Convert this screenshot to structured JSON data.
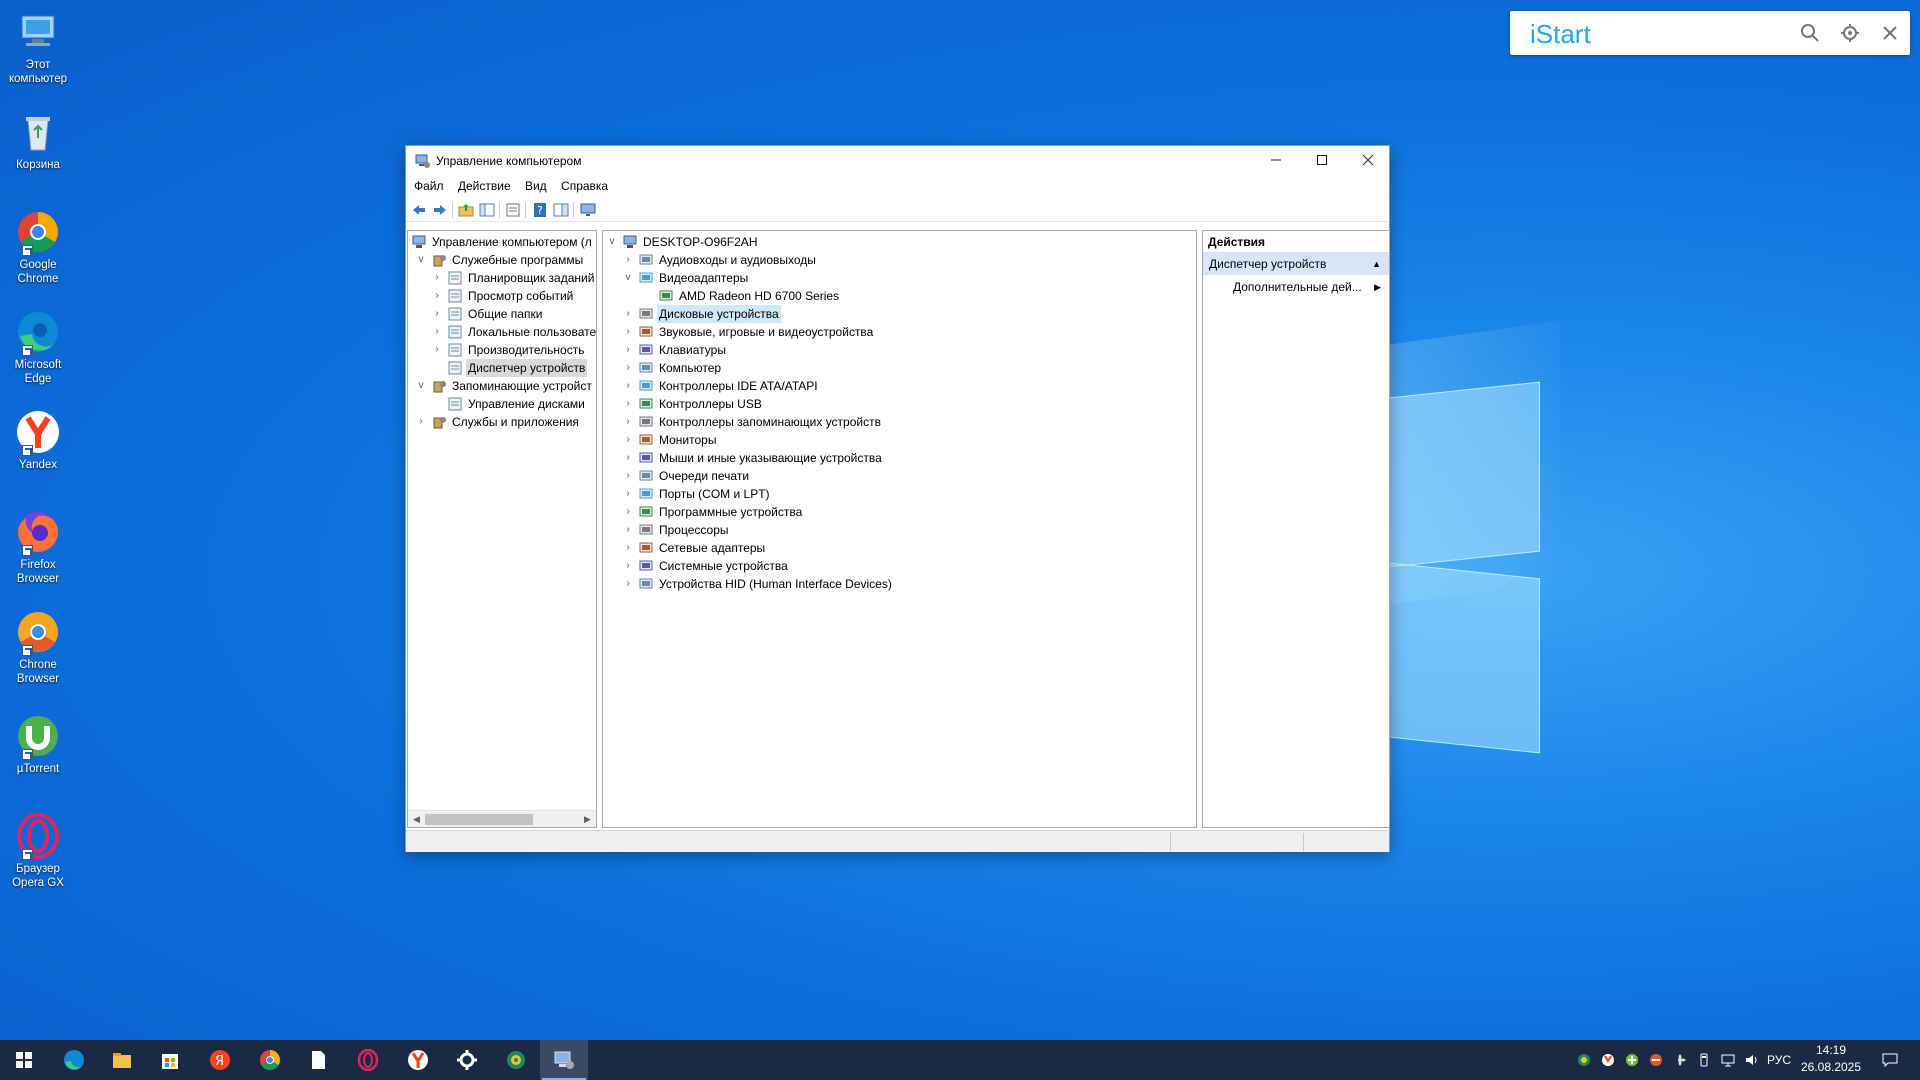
{
  "desktop": {
    "icons": [
      {
        "label": "Этот компьютер",
        "icon": "this-pc-icon"
      },
      {
        "label": "Корзина",
        "icon": "recycle-bin-icon"
      },
      {
        "label": "Google Chrome",
        "icon": "chrome-icon"
      },
      {
        "label": "Microsoft Edge",
        "icon": "edge-icon"
      },
      {
        "label": "Yandex",
        "icon": "yandex-icon"
      },
      {
        "label": "Firefox Browser",
        "icon": "firefox-icon"
      },
      {
        "label": "Chrone Browser",
        "icon": "chrone-icon"
      },
      {
        "label": "µTorrent",
        "icon": "utorrent-icon"
      },
      {
        "label": "Браузер Opera GX",
        "icon": "opera-gx-icon"
      }
    ]
  },
  "istart": {
    "brand": "iStart"
  },
  "window": {
    "title": "Управление компьютером",
    "menu": [
      "Файл",
      "Действие",
      "Вид",
      "Справка"
    ],
    "left_tree": [
      {
        "label": "Управление компьютером (л",
        "level": 0,
        "expander": ""
      },
      {
        "label": "Служебные программы",
        "level": 1,
        "expander": "v"
      },
      {
        "label": "Планировщик заданий",
        "level": 2,
        "expander": ">"
      },
      {
        "label": "Просмотр событий",
        "level": 2,
        "expander": ">"
      },
      {
        "label": "Общие папки",
        "level": 2,
        "expander": ">"
      },
      {
        "label": "Локальные пользовате",
        "level": 2,
        "expander": ">"
      },
      {
        "label": "Производительность",
        "level": 2,
        "expander": ">"
      },
      {
        "label": "Диспетчер устройств",
        "level": 2,
        "expander": "",
        "selected": true
      },
      {
        "label": "Запоминающие устройст",
        "level": 1,
        "expander": "v"
      },
      {
        "label": "Управление дисками",
        "level": 2,
        "expander": ""
      },
      {
        "label": "Службы и приложения",
        "level": 1,
        "expander": ">"
      }
    ],
    "device_tree": {
      "root": "DESKTOP-O96F2AH",
      "items": [
        {
          "label": "Аудиовходы и аудиовыходы",
          "level": 1,
          "expander": ">"
        },
        {
          "label": "Видеоадаптеры",
          "level": 1,
          "expander": "v"
        },
        {
          "label": "AMD Radeon HD 6700 Series",
          "level": 2,
          "expander": ""
        },
        {
          "label": "Дисковые устройства",
          "level": 1,
          "expander": ">",
          "highlighted": true
        },
        {
          "label": "Звуковые, игровые и видеоустройства",
          "level": 1,
          "expander": ">"
        },
        {
          "label": "Клавиатуры",
          "level": 1,
          "expander": ">"
        },
        {
          "label": "Компьютер",
          "level": 1,
          "expander": ">"
        },
        {
          "label": "Контроллеры IDE ATA/ATAPI",
          "level": 1,
          "expander": ">"
        },
        {
          "label": "Контроллеры USB",
          "level": 1,
          "expander": ">"
        },
        {
          "label": "Контроллеры запоминающих устройств",
          "level": 1,
          "expander": ">"
        },
        {
          "label": "Мониторы",
          "level": 1,
          "expander": ">"
        },
        {
          "label": "Мыши и иные указывающие устройства",
          "level": 1,
          "expander": ">"
        },
        {
          "label": "Очереди печати",
          "level": 1,
          "expander": ">"
        },
        {
          "label": "Порты (COM и LPT)",
          "level": 1,
          "expander": ">"
        },
        {
          "label": "Программные устройства",
          "level": 1,
          "expander": ">"
        },
        {
          "label": "Процессоры",
          "level": 1,
          "expander": ">"
        },
        {
          "label": "Сетевые адаптеры",
          "level": 1,
          "expander": ">"
        },
        {
          "label": "Системные устройства",
          "level": 1,
          "expander": ">"
        },
        {
          "label": "Устройства HID (Human Interface Devices)",
          "level": 1,
          "expander": ">"
        }
      ]
    },
    "actions": {
      "header": "Действия",
      "section": "Диспетчер устройств",
      "more": "Дополнительные дей..."
    }
  },
  "taskbar": {
    "apps": [
      "start-icon",
      "edge-icon",
      "file-explorer-icon",
      "store-icon",
      "yandex-browser-icon",
      "chrome-icon",
      "notepad-icon",
      "opera-icon",
      "yandex-icon",
      "settings-icon",
      "globe-icon",
      "computer-management-icon"
    ],
    "language": "РУС",
    "time": "14:19",
    "date": "26.08.2025"
  },
  "colors": {
    "accent": "#0078d7",
    "selection": "#cce8ff",
    "desktop": "#0c6fdc"
  }
}
